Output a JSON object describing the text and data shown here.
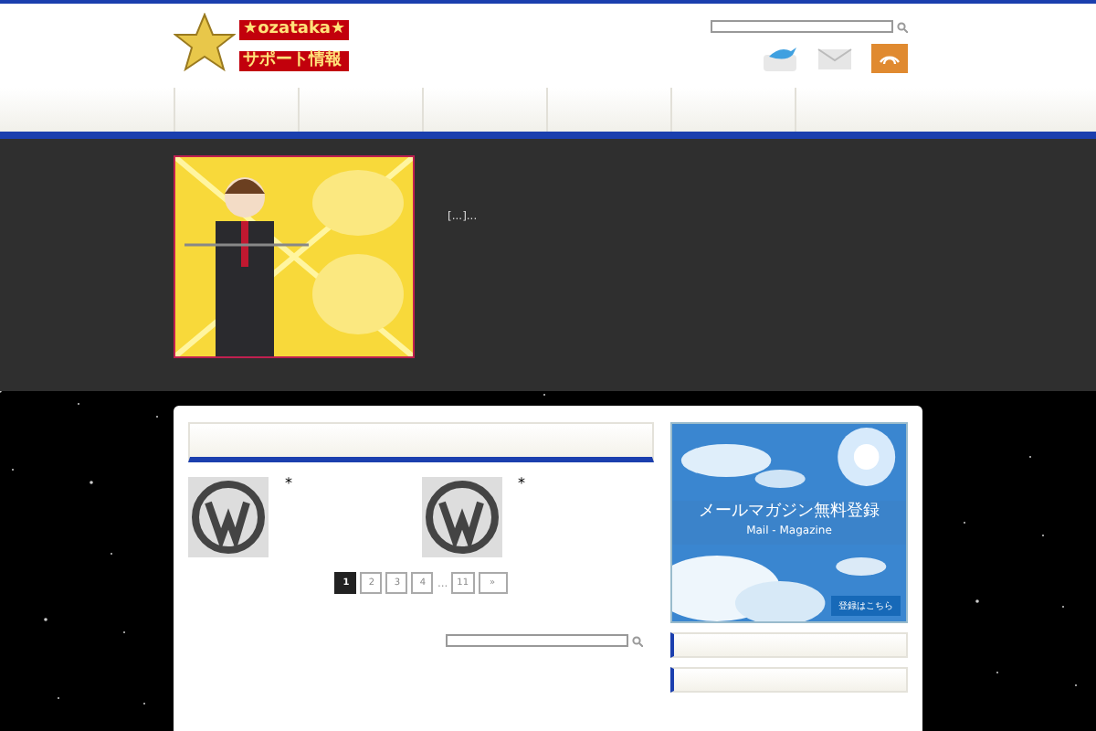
{
  "header": {
    "logo_top": "★ozataka★",
    "logo_bottom": "サポート情報"
  },
  "featured": {
    "excerpt": "[...]..."
  },
  "posts": [
    {
      "marker": "*"
    },
    {
      "marker": "*"
    }
  ],
  "pagination": [
    {
      "label": "1",
      "selected": true
    },
    {
      "label": "2",
      "selected": false
    },
    {
      "label": "3",
      "selected": false
    },
    {
      "label": "4",
      "selected": false
    },
    {
      "label": "...",
      "kind": "gap"
    },
    {
      "label": "11",
      "selected": false
    },
    {
      "label": "»",
      "selected": false
    }
  ],
  "banner": {
    "title": "メールマガジン無料登録",
    "subtitle": "Mail - Magazine",
    "button": "登録はこちら"
  }
}
